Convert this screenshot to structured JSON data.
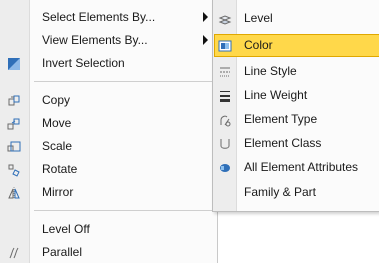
{
  "main_menu": {
    "items": [
      {
        "label": "Select Elements By...",
        "icon": "",
        "submenu": true
      },
      {
        "label": "View Elements By...",
        "icon": "",
        "submenu": true
      },
      {
        "label": "Invert Selection",
        "icon": "invert-selection-icon",
        "submenu": false
      },
      {
        "label": "Copy",
        "icon": "copy-icon",
        "submenu": false
      },
      {
        "label": "Move",
        "icon": "move-icon",
        "submenu": false
      },
      {
        "label": "Scale",
        "icon": "scale-icon",
        "submenu": false
      },
      {
        "label": "Rotate",
        "icon": "rotate-icon",
        "submenu": false
      },
      {
        "label": "Mirror",
        "icon": "mirror-icon",
        "submenu": false
      },
      {
        "label": "Level Off",
        "icon": "",
        "submenu": false
      },
      {
        "label": "Parallel",
        "icon": "parallel-icon",
        "submenu": false
      }
    ]
  },
  "sub_menu": {
    "items": [
      {
        "label": "Level",
        "icon": "level-icon"
      },
      {
        "label": "Color",
        "icon": "color-icon",
        "highlighted": true
      },
      {
        "label": "Line Style",
        "icon": "line-style-icon"
      },
      {
        "label": "Line Weight",
        "icon": "line-weight-icon"
      },
      {
        "label": "Element Type",
        "icon": "element-type-icon"
      },
      {
        "label": "Element Class",
        "icon": "element-class-icon"
      },
      {
        "label": "All Element Attributes",
        "icon": "all-attributes-icon"
      },
      {
        "label": "Family & Part",
        "icon": ""
      }
    ]
  },
  "colors": {
    "highlight": "#ffd84a",
    "highlight_border": "#e0a800",
    "icon_blue": "#2f6fb8",
    "icon_gray": "#6a6a6a"
  }
}
